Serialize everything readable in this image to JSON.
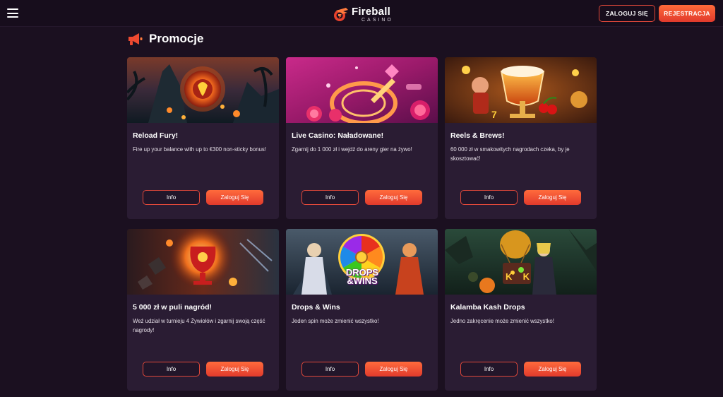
{
  "header": {
    "brand_name": "Fireball",
    "brand_sub": "CASINO",
    "login_label": "ZALOGUJ SIĘ",
    "register_label": "REJESTRACJA"
  },
  "section": {
    "title": "Promocje"
  },
  "colors": {
    "background": "#1b1020",
    "card": "#2a1c33",
    "accent": "#e13a2c",
    "accent_light": "#ff6a3a"
  },
  "promotions": [
    {
      "title": "Reload Fury!",
      "description": "Fire up your balance with up to €300 non-sticky bonus!",
      "info_label": "Info",
      "login_label": "Zaloguj Się"
    },
    {
      "title": "Live Casino: Naładowane!",
      "description": "Zgarnij do 1 000 zł i wejdź do areny gier na żywo!",
      "info_label": "Info",
      "login_label": "Zaloguj Się"
    },
    {
      "title": "Reels & Brews!",
      "description": "60 000 zł w smakowitych nagrodach czeka, by je skosztować!",
      "info_label": "Info",
      "login_label": "Zaloguj Się"
    },
    {
      "title": "5 000 zł w puli nagród!",
      "description": "Weź udział w turnieju 4 Żywiołów i zgarnij swoją część nagrody!",
      "info_label": "Info",
      "login_label": "Zaloguj Się"
    },
    {
      "title": "Drops & Wins",
      "description": "Jeden spin może zmienić wszystko!",
      "image_text_1": "DROPS",
      "image_text_2": "&WINS",
      "info_label": "Info",
      "login_label": "Zaloguj Się"
    },
    {
      "title": "Kalamba Kash Drops",
      "description": "Jedno zakręcenie może zmienić wszystko!",
      "image_text_1": "K",
      "image_text_2": "K",
      "info_label": "Info",
      "login_label": "Zaloguj Się"
    }
  ]
}
